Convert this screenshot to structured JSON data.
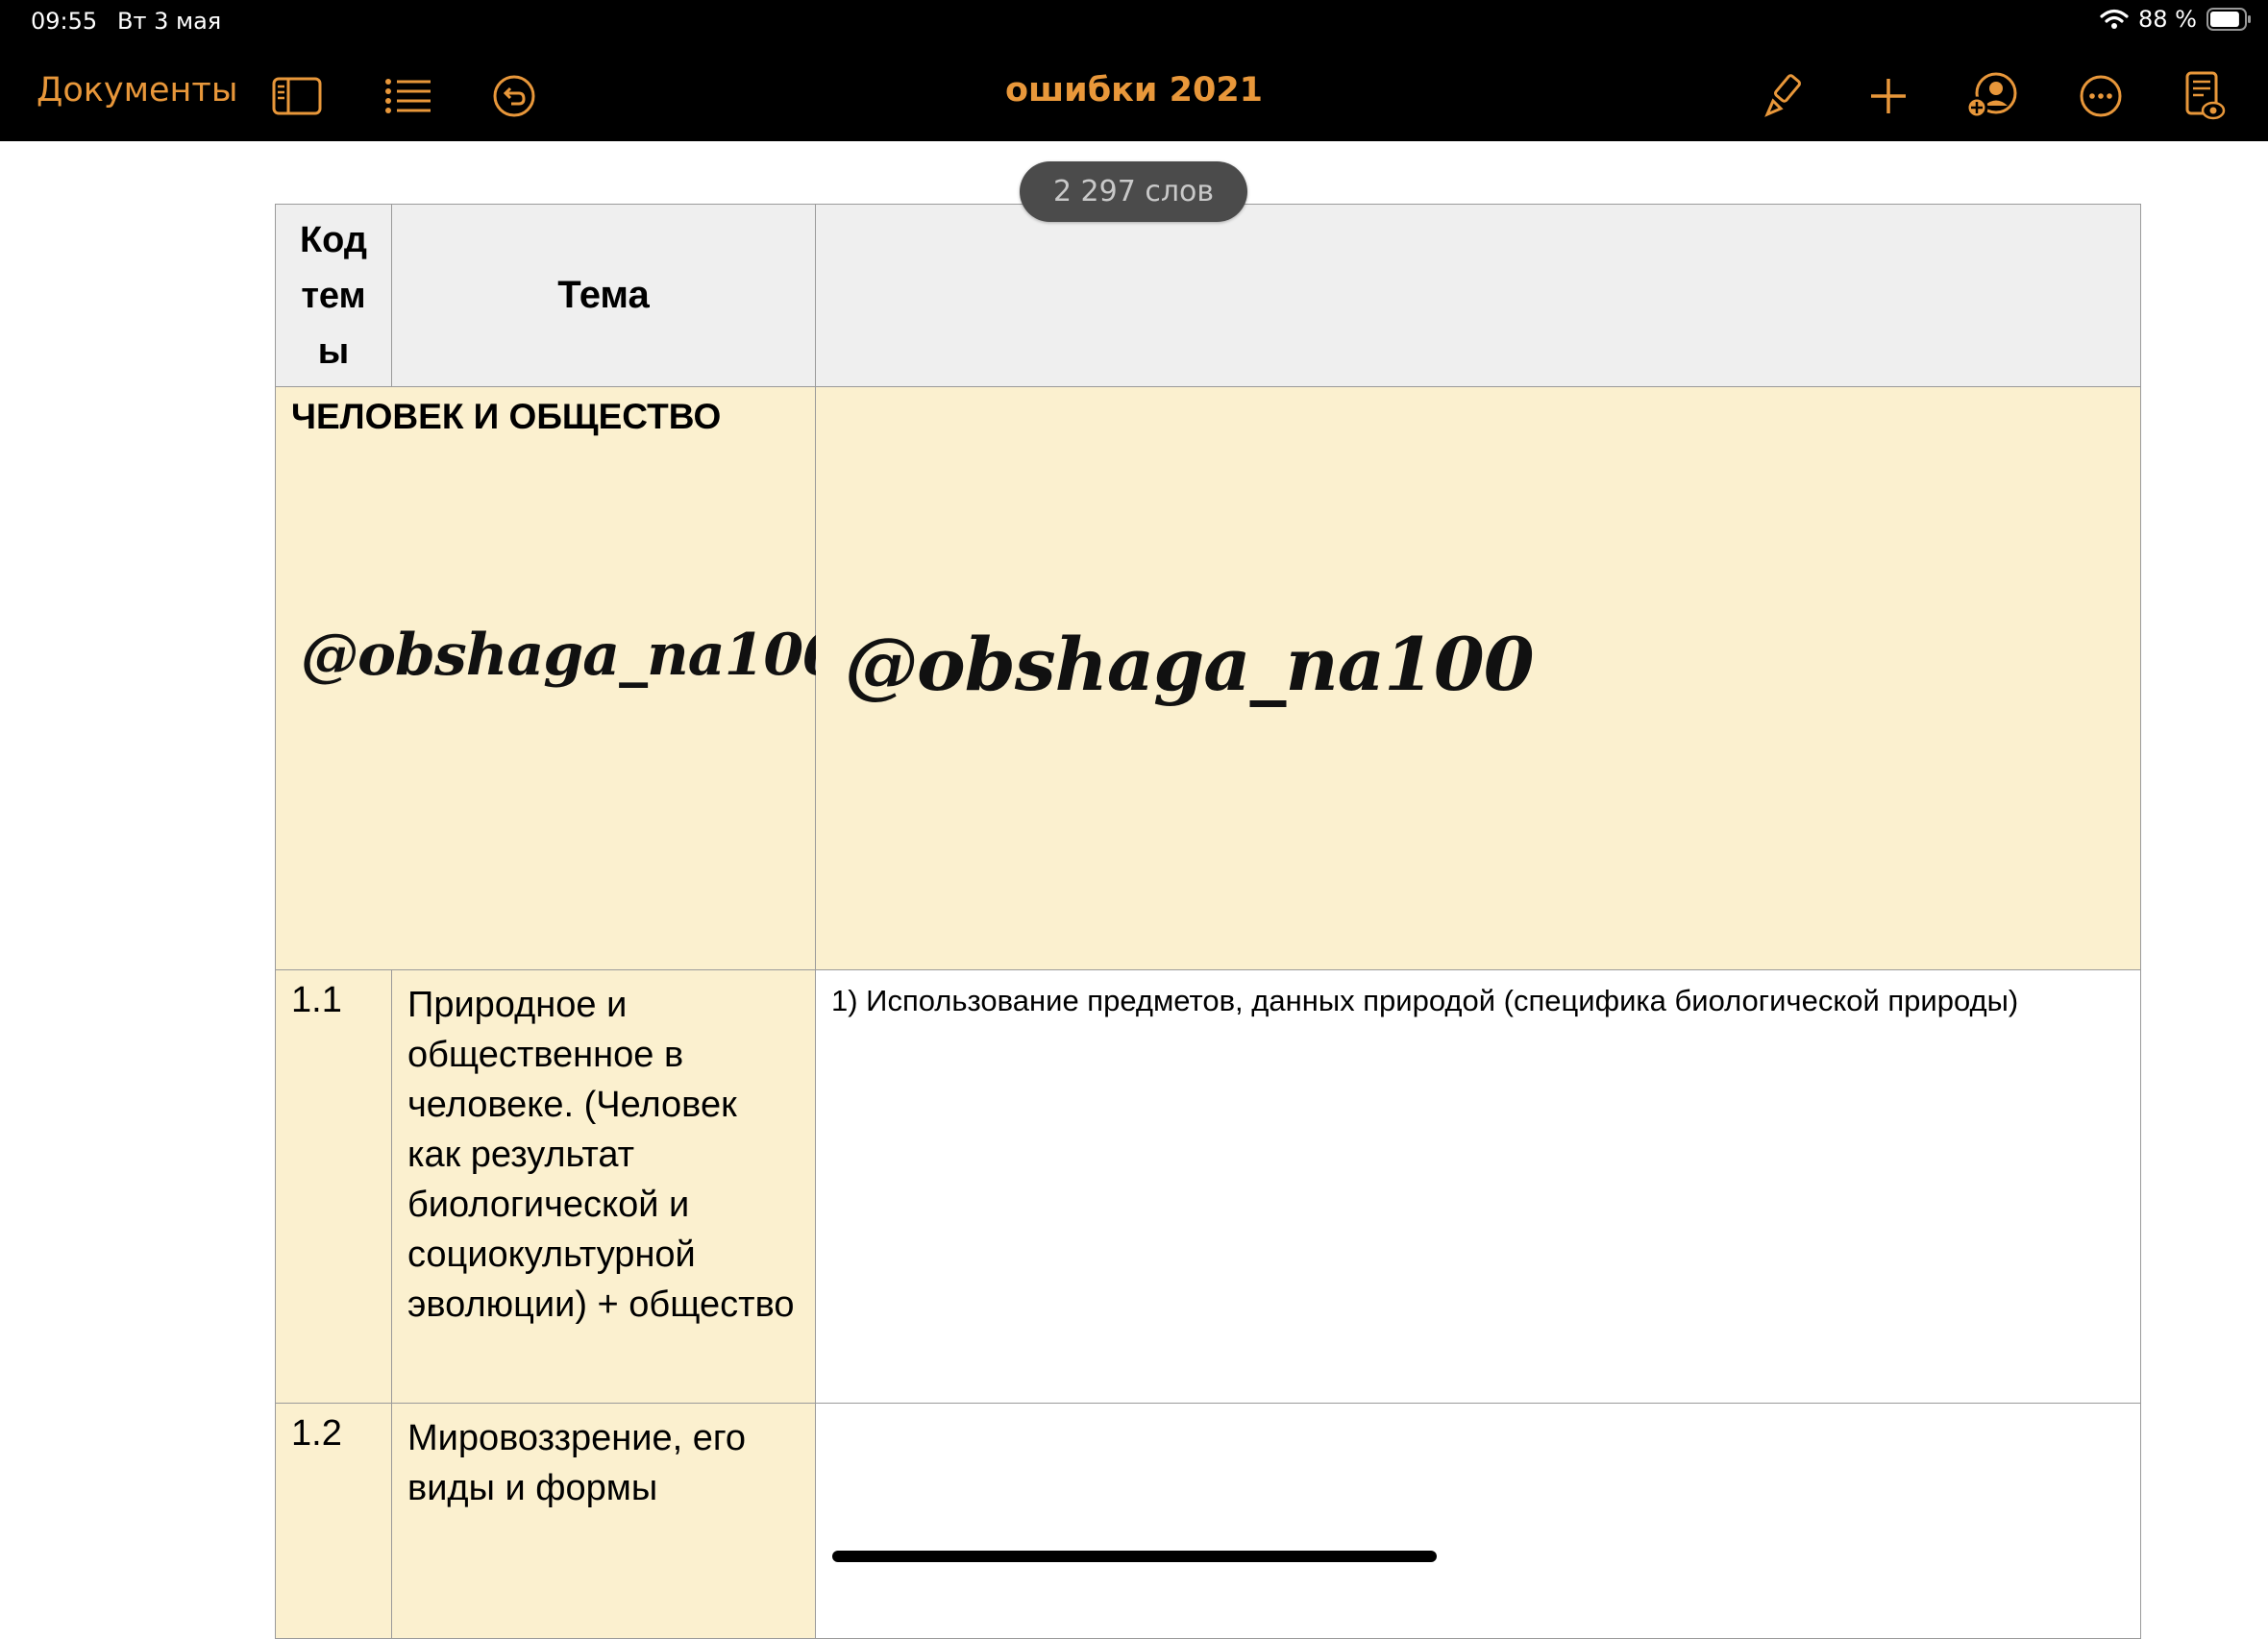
{
  "status_bar": {
    "time": "09:55",
    "date": "Вт 3 мая",
    "battery": "88 %",
    "battery_level": 0.88
  },
  "toolbar": {
    "documents_label": "Документы",
    "title": "ошибки 2021",
    "accent_color": "#e8973a",
    "left_icons": [
      "sidebar-icon",
      "list-icon",
      "undo-icon"
    ],
    "right_icons": [
      "paintbrush-icon",
      "plus-icon",
      "collaborate-icon",
      "more-icon",
      "document-view-icon"
    ]
  },
  "word_count": "2 297 слов",
  "table": {
    "header": {
      "code": [
        "Код",
        "тем",
        "ы"
      ],
      "topic": "Тема",
      "notes": ""
    },
    "section": {
      "title": "ЧЕЛОВЕК И ОБЩЕСТВО",
      "watermark": "@obshaga_na100"
    },
    "rows": [
      {
        "code": "1.1",
        "topic": "Природное и общественное в человеке. (Человек как результат биологической и социокультурной эволюции) + общество",
        "note": "1) Использование предметов, данных природой (специфика биологической природы)"
      },
      {
        "code": "1.2",
        "topic": "Мировоззрение, его виды и формы",
        "note": ""
      }
    ]
  },
  "colors": {
    "section_fill": "#fbf0cf",
    "header_fill": "#efefef",
    "grid_line": "#9a9a9a"
  }
}
